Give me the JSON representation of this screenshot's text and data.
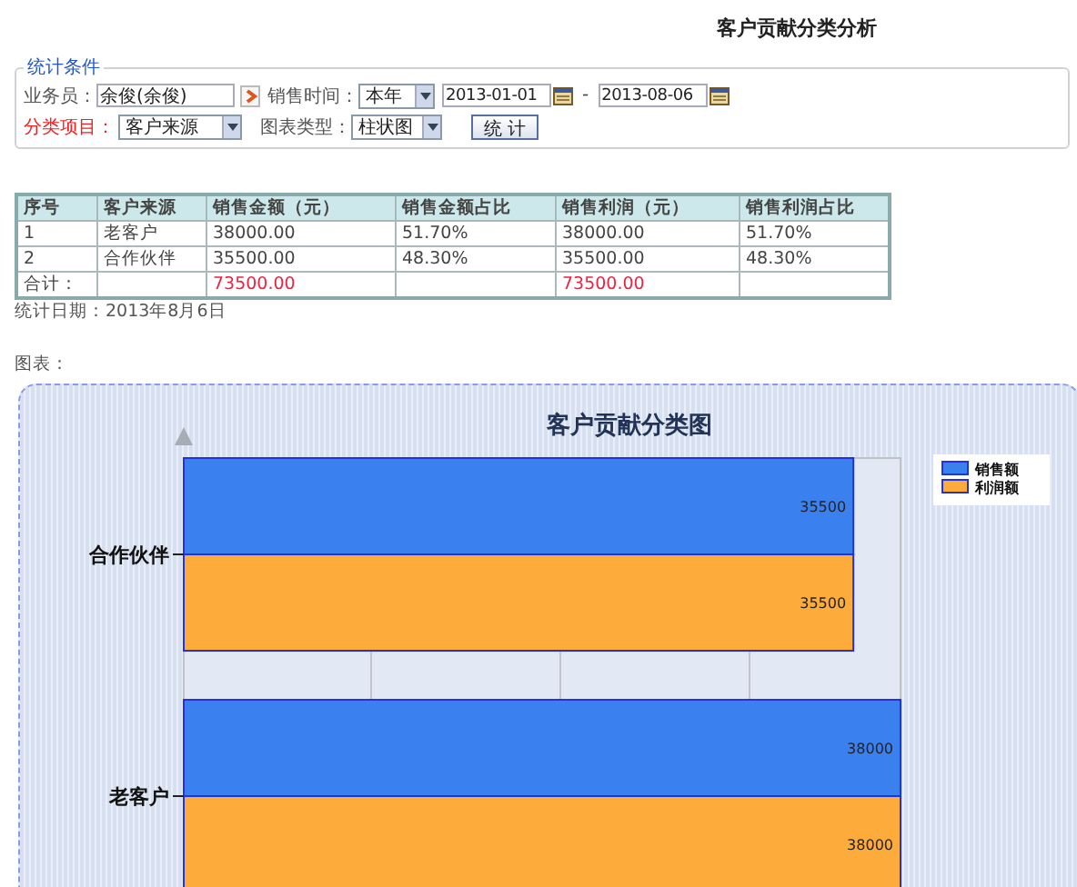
{
  "page_title": "客户贡献分类分析",
  "filter": {
    "legend": "统计条件",
    "salesperson": {
      "label": "业务员：",
      "value": "余俊(余俊)"
    },
    "sales_time": {
      "label": "销售时间：",
      "period": "本年",
      "start": "2013-01-01",
      "separator": "-",
      "end": "2013-08-06"
    },
    "category": {
      "label": "分类项目：",
      "value": "客户来源"
    },
    "chart_type": {
      "label": "图表类型：",
      "value": "柱状图"
    },
    "submit": "统 计"
  },
  "table": {
    "columns": [
      "序号",
      "客户来源",
      "销售金额（元）",
      "销售金额占比",
      "销售利润（元）",
      "销售利润占比"
    ],
    "rows": [
      [
        "1",
        "老客户",
        "38000.00",
        "51.70%",
        "38000.00",
        "51.70%"
      ],
      [
        "2",
        "合作伙伴",
        "35500.00",
        "48.30%",
        "35500.00",
        "48.30%"
      ]
    ],
    "total": {
      "label": "合计：",
      "sales_amount": "73500.00",
      "profit": "73500.00"
    }
  },
  "stat_date": "统计日期：2013年8月6日",
  "chart_label": "图表：",
  "chart_data": {
    "type": "bar",
    "title": "客户贡献分类图",
    "orientation": "horizontal",
    "categories": [
      "合作伙伴",
      "老客户"
    ],
    "series": [
      {
        "name": "销售额",
        "color": "#3a80ee",
        "values": [
          35500,
          38000
        ]
      },
      {
        "name": "利润额",
        "color": "#fdab3a",
        "values": [
          35500,
          38000
        ]
      }
    ],
    "data_labels": true,
    "legend": "right"
  }
}
